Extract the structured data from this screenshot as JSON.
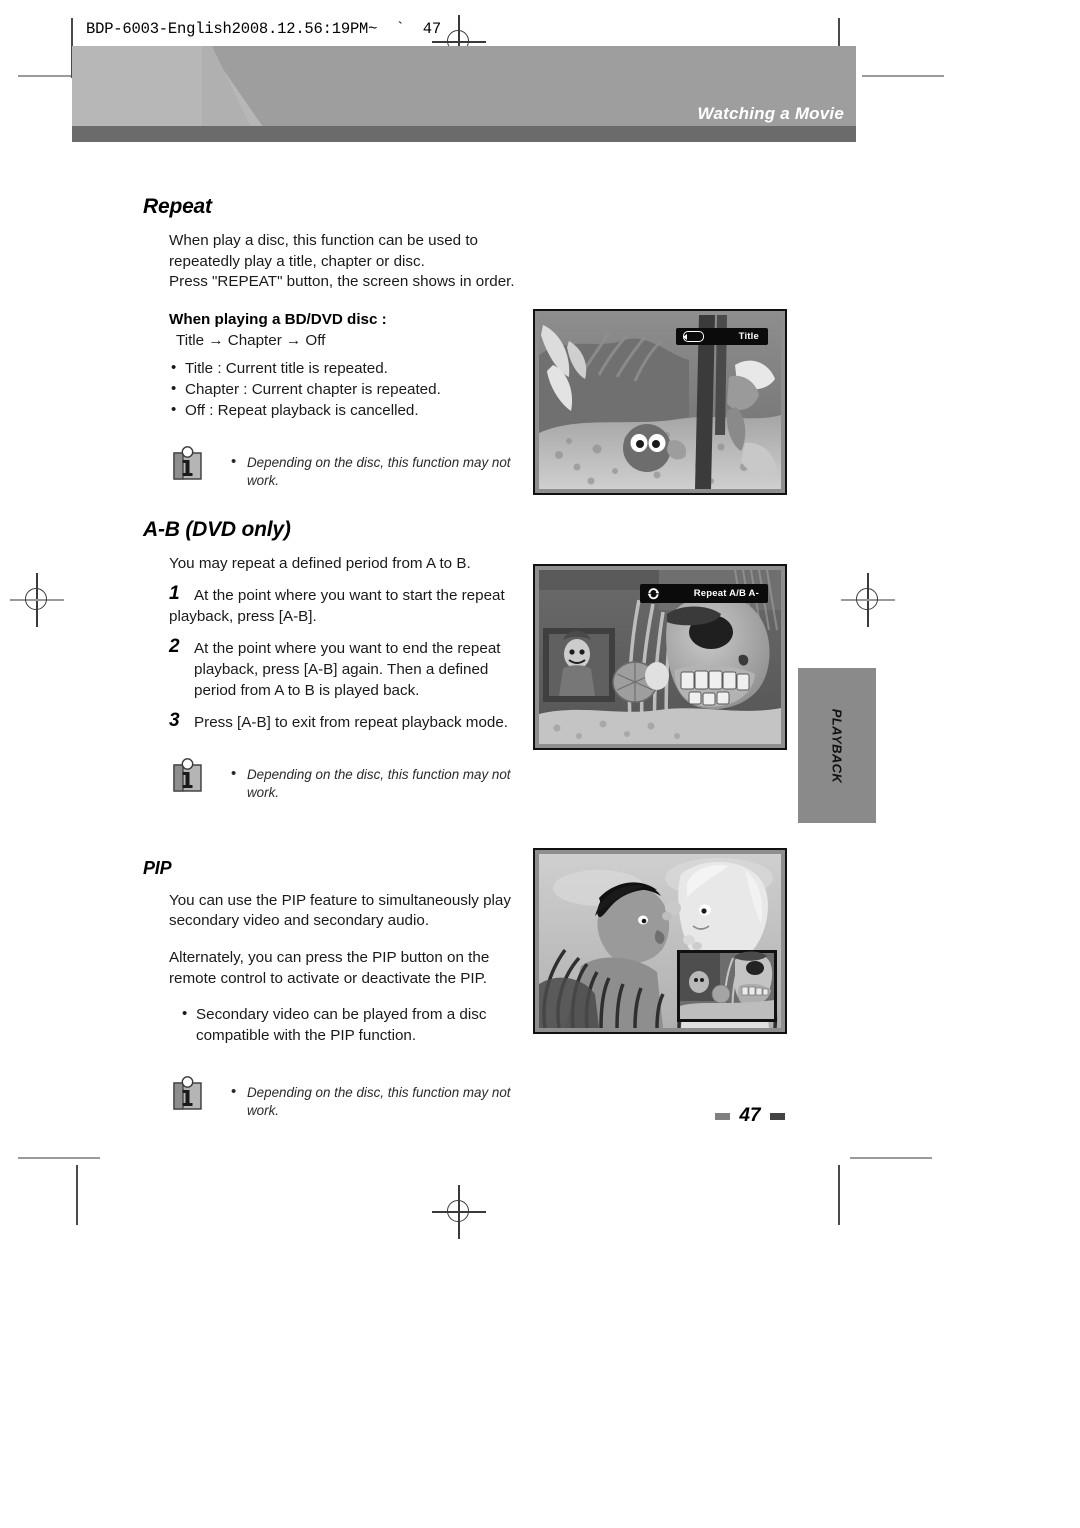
{
  "document": {
    "file_stamp": "BDP-6003-English2008.12.56:19PM~  `  47",
    "header_title": "Watching a Movie",
    "side_tab_label": "PLAYBACK",
    "page_number": "47"
  },
  "sections": [
    {
      "id": "repeat",
      "title": "Repeat",
      "paragraphs": [
        "When play a disc, this function can be used to repeatedly play a title, chapter or disc.",
        "Press \"REPEAT\" button, the screen shows in order."
      ],
      "sub_head": "When playing a BD/DVD disc :",
      "sequence": "Title → Chapter → Off",
      "bullets": [
        "Title  : Current title is repeated.",
        "Chapter  : Current chapter is repeated.",
        "Off : Repeat playback is cancelled."
      ],
      "note": "Depending on the disc, this function may not work."
    },
    {
      "id": "ab",
      "title": "A-B (DVD only)",
      "intro": "You may repeat a defined period from A to B.",
      "steps": [
        {
          "num": "1",
          "text": "At the point where you want to start the repeat",
          "cont": "playback, press [A-B]."
        },
        {
          "num": "2",
          "text": "At the point where you want to end the repeat playback, press [A-B] again. Then a defined period from A to B is played back.",
          "cont": ""
        },
        {
          "num": "3",
          "text": "Press [A-B] to exit from repeat playback mode.",
          "cont": ""
        }
      ],
      "note": "Depending on the disc, this function may not work."
    },
    {
      "id": "pip",
      "title": "PIP",
      "paragraphs": [
        "You can use the PIP feature to simultaneously play secondary video and secondary audio.",
        "Alternately, you can press the PIP button on the remote control to activate or deactivate the PIP."
      ],
      "bullets": [
        "Secondary video can be played from a disc compatible with the PIP function."
      ],
      "note": "Depending on the disc, this function may not work."
    }
  ],
  "screenshots": [
    {
      "id": "shot-title",
      "caption_osd_icon": "repeat-loop-icon",
      "osd_text": "Title",
      "scene": "aquarium-fish-scene"
    },
    {
      "id": "shot-ab",
      "caption_osd_icon": "repeat-cycle-icon",
      "osd_text": "Repeat A/B  A-",
      "scene": "skull-aquarium-scene"
    },
    {
      "id": "shot-pip",
      "caption_osd_icon": "",
      "osd_text": "",
      "scene": "pip-two-characters-scene"
    }
  ],
  "colors": {
    "header_light": "#b7b7b7",
    "header_dark": "#9e9e9e",
    "header_underbar": "#6b6b6b",
    "side_tab": "#8a8a8a",
    "osd_bg": "#0b0b0b"
  }
}
